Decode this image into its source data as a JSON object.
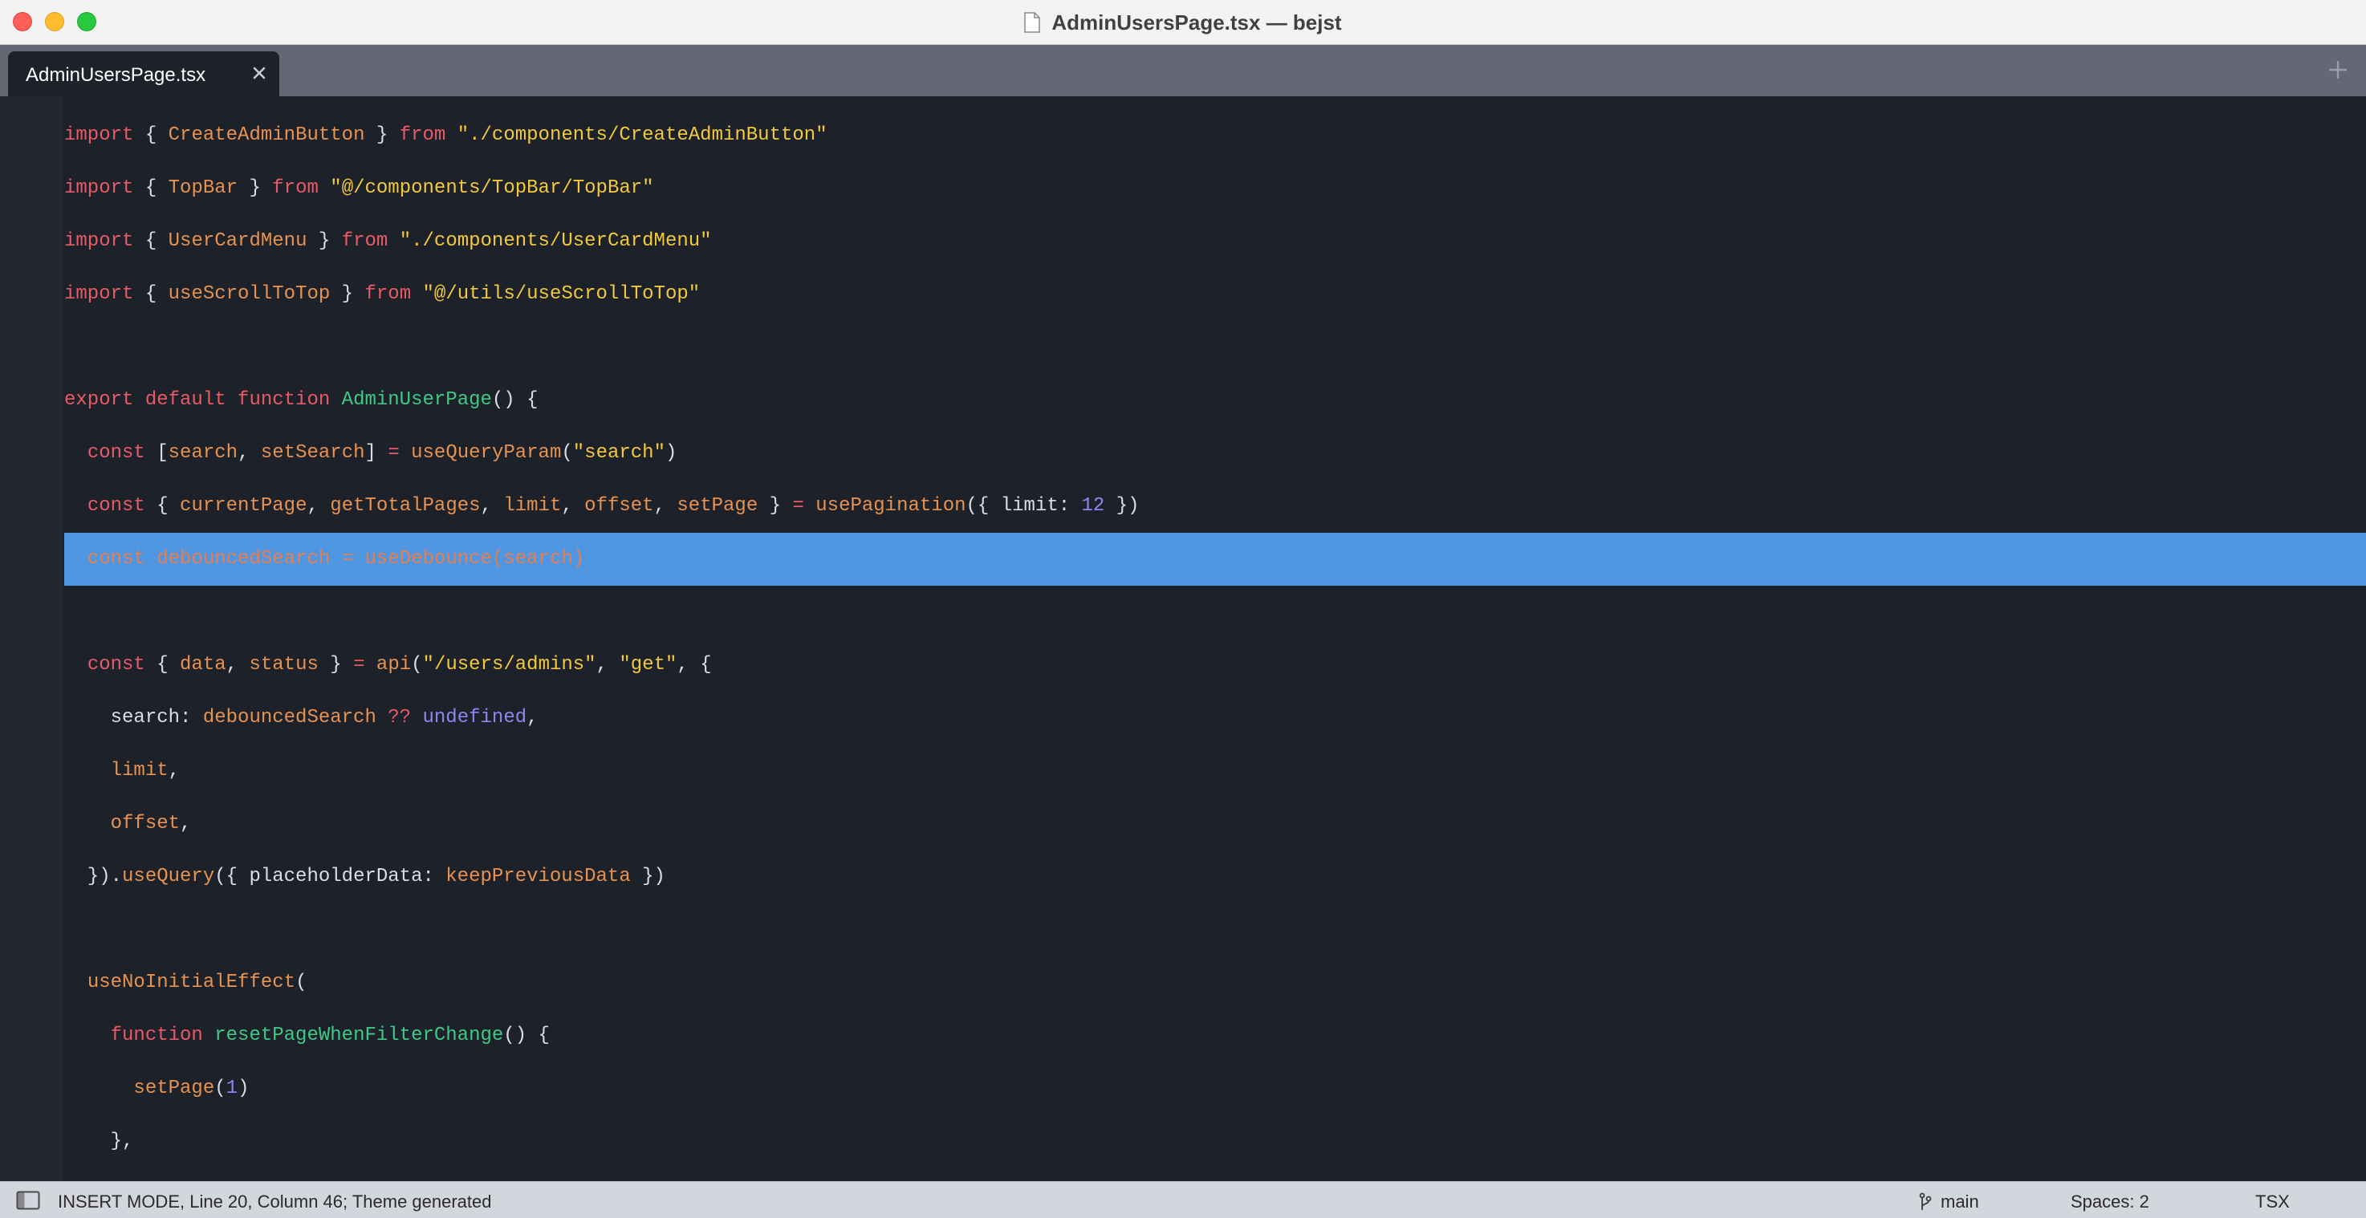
{
  "window": {
    "title": "AdminUsersPage.tsx — bejst"
  },
  "tabs": [
    {
      "label": "AdminUsersPage.tsx",
      "active": true
    }
  ],
  "icons": {
    "document": "document-icon",
    "tab_close": "close-icon",
    "new_tab": "plus-icon",
    "sidebar_toggle": "sidebar-toggle-icon",
    "branch": "git-branch-icon"
  },
  "colors": {
    "selection": "#5196e0",
    "keyword": "#e85a66",
    "identifier": "#e8924f",
    "string": "#f2c93b",
    "function": "#3fc985",
    "number": "#8c86ef",
    "editor_background": "#1d212a"
  },
  "editor": {
    "selected_line_index": 8,
    "lines": [
      [
        [
          "kw",
          "import"
        ],
        [
          "pl",
          " { "
        ],
        [
          "id",
          "CreateAdminButton"
        ],
        [
          "pl",
          " } "
        ],
        [
          "kw",
          "from"
        ],
        [
          "pl",
          " "
        ],
        [
          "str",
          "\"./components/CreateAdminButton\""
        ]
      ],
      [
        [
          "kw",
          "import"
        ],
        [
          "pl",
          " { "
        ],
        [
          "id",
          "TopBar"
        ],
        [
          "pl",
          " } "
        ],
        [
          "kw",
          "from"
        ],
        [
          "pl",
          " "
        ],
        [
          "str",
          "\"@/components/TopBar/TopBar\""
        ]
      ],
      [
        [
          "kw",
          "import"
        ],
        [
          "pl",
          " { "
        ],
        [
          "id",
          "UserCardMenu"
        ],
        [
          "pl",
          " } "
        ],
        [
          "kw",
          "from"
        ],
        [
          "pl",
          " "
        ],
        [
          "str",
          "\"./components/UserCardMenu\""
        ]
      ],
      [
        [
          "kw",
          "import"
        ],
        [
          "pl",
          " { "
        ],
        [
          "id",
          "useScrollToTop"
        ],
        [
          "pl",
          " } "
        ],
        [
          "kw",
          "from"
        ],
        [
          "pl",
          " "
        ],
        [
          "str",
          "\"@/utils/useScrollToTop\""
        ]
      ],
      [],
      [
        [
          "kw",
          "export default function"
        ],
        [
          "pl",
          " "
        ],
        [
          "fn",
          "AdminUserPage"
        ],
        [
          "pl",
          "() {"
        ]
      ],
      [
        [
          "pl",
          "  "
        ],
        [
          "kw",
          "const"
        ],
        [
          "pl",
          " ["
        ],
        [
          "id",
          "search"
        ],
        [
          "pl",
          ", "
        ],
        [
          "id",
          "setSearch"
        ],
        [
          "pl",
          "] "
        ],
        [
          "kw",
          "="
        ],
        [
          "pl",
          " "
        ],
        [
          "id",
          "useQueryParam"
        ],
        [
          "pl",
          "("
        ],
        [
          "str",
          "\"search\""
        ],
        [
          "pl",
          ")"
        ]
      ],
      [
        [
          "pl",
          "  "
        ],
        [
          "kw",
          "const"
        ],
        [
          "pl",
          " { "
        ],
        [
          "id",
          "currentPage"
        ],
        [
          "pl",
          ", "
        ],
        [
          "id",
          "getTotalPages"
        ],
        [
          "pl",
          ", "
        ],
        [
          "id",
          "limit"
        ],
        [
          "pl",
          ", "
        ],
        [
          "id",
          "offset"
        ],
        [
          "pl",
          ", "
        ],
        [
          "id",
          "setPage"
        ],
        [
          "pl",
          " } "
        ],
        [
          "kw",
          "="
        ],
        [
          "pl",
          " "
        ],
        [
          "id",
          "usePagination"
        ],
        [
          "pl",
          "({ limit: "
        ],
        [
          "num",
          "12"
        ],
        [
          "pl",
          " })"
        ]
      ],
      [
        [
          "pl",
          "  "
        ],
        [
          "kw",
          "const"
        ],
        [
          "pl",
          " "
        ],
        [
          "id",
          "debouncedSearch"
        ],
        [
          "pl",
          " "
        ],
        [
          "kw",
          "="
        ],
        [
          "pl",
          " "
        ],
        [
          "id",
          "useDebounce"
        ],
        [
          "pl",
          "("
        ],
        [
          "id",
          "search"
        ],
        [
          "pl",
          ")"
        ]
      ],
      [],
      [
        [
          "pl",
          "  "
        ],
        [
          "kw",
          "const"
        ],
        [
          "pl",
          " { "
        ],
        [
          "id",
          "data"
        ],
        [
          "pl",
          ", "
        ],
        [
          "id",
          "status"
        ],
        [
          "pl",
          " } "
        ],
        [
          "kw",
          "="
        ],
        [
          "pl",
          " "
        ],
        [
          "id",
          "api"
        ],
        [
          "pl",
          "("
        ],
        [
          "str",
          "\"/users/admins\""
        ],
        [
          "pl",
          ", "
        ],
        [
          "str",
          "\"get\""
        ],
        [
          "pl",
          ", {"
        ]
      ],
      [
        [
          "pl",
          "    search: "
        ],
        [
          "id",
          "debouncedSearch"
        ],
        [
          "pl",
          " "
        ],
        [
          "kw",
          "??"
        ],
        [
          "pl",
          " "
        ],
        [
          "con",
          "undefined"
        ],
        [
          "pl",
          ","
        ]
      ],
      [
        [
          "pl",
          "    "
        ],
        [
          "id",
          "limit"
        ],
        [
          "pl",
          ","
        ]
      ],
      [
        [
          "pl",
          "    "
        ],
        [
          "id",
          "offset"
        ],
        [
          "pl",
          ","
        ]
      ],
      [
        [
          "pl",
          "  })."
        ],
        [
          "id",
          "useQuery"
        ],
        [
          "pl",
          "({ placeholderData: "
        ],
        [
          "id",
          "keepPreviousData"
        ],
        [
          "pl",
          " })"
        ]
      ],
      [],
      [
        [
          "pl",
          "  "
        ],
        [
          "id",
          "useNoInitialEffect"
        ],
        [
          "pl",
          "("
        ]
      ],
      [
        [
          "pl",
          "    "
        ],
        [
          "kw",
          "function"
        ],
        [
          "pl",
          " "
        ],
        [
          "fn",
          "resetPageWhenFilterChange"
        ],
        [
          "pl",
          "() {"
        ]
      ],
      [
        [
          "pl",
          "      "
        ],
        [
          "id",
          "setPage"
        ],
        [
          "pl",
          "("
        ],
        [
          "num",
          "1"
        ],
        [
          "pl",
          ")"
        ]
      ],
      [
        [
          "pl",
          "    },"
        ]
      ]
    ]
  },
  "statusbar": {
    "mode": "INSERT MODE, Line 20, Column 46; Theme generated",
    "branch": "main",
    "indentation": "Spaces: 2",
    "syntax": "TSX"
  }
}
